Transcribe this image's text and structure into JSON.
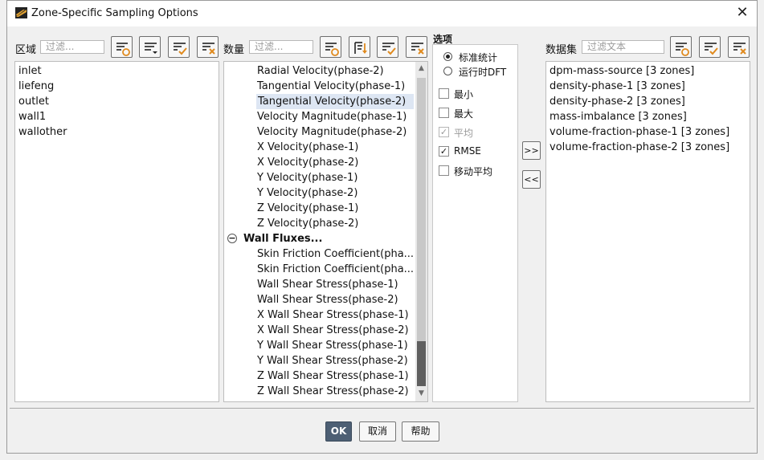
{
  "window": {
    "title": "Zone-Specific Sampling Options",
    "close_glyph": "✕"
  },
  "zones": {
    "label": "区域",
    "filter_placeholder": "过滤...",
    "items": [
      "inlet",
      "liefeng",
      "outlet",
      "wall1",
      "wallother"
    ]
  },
  "quantities": {
    "label": "数量",
    "filter_placeholder": "过滤...",
    "items": [
      {
        "text": "Radial Velocity(phase-2)"
      },
      {
        "text": "Tangential Velocity(phase-1)"
      },
      {
        "text": "Tangential Velocity(phase-2)",
        "selected": true
      },
      {
        "text": "Velocity Magnitude(phase-1)"
      },
      {
        "text": "Velocity Magnitude(phase-2)"
      },
      {
        "text": "X Velocity(phase-1)"
      },
      {
        "text": "X Velocity(phase-2)"
      },
      {
        "text": "Y Velocity(phase-1)"
      },
      {
        "text": "Y Velocity(phase-2)"
      },
      {
        "text": "Z Velocity(phase-1)"
      },
      {
        "text": "Z Velocity(phase-2)"
      },
      {
        "text": "Wall Fluxes...",
        "group": true
      },
      {
        "text": "Skin Friction Coefficient(pha..."
      },
      {
        "text": "Skin Friction Coefficient(pha..."
      },
      {
        "text": "Wall Shear Stress(phase-1)"
      },
      {
        "text": "Wall Shear Stress(phase-2)"
      },
      {
        "text": "X Wall Shear Stress(phase-1)"
      },
      {
        "text": "X Wall Shear Stress(phase-2)"
      },
      {
        "text": "Y Wall Shear Stress(phase-1)"
      },
      {
        "text": "Y Wall Shear Stress(phase-2)"
      },
      {
        "text": "Z Wall Shear Stress(phase-1)"
      },
      {
        "text": "Z Wall Shear Stress(phase-2)"
      }
    ],
    "collapse_glyph": "−"
  },
  "options": {
    "label": "选项",
    "radios": [
      {
        "text": "标准统计",
        "checked": true
      },
      {
        "text": "运行时DFT",
        "checked": false
      }
    ],
    "checks": [
      {
        "text": "最小",
        "checked": false,
        "disabled": false
      },
      {
        "text": "最大",
        "checked": false,
        "disabled": false
      },
      {
        "text": "平均",
        "checked": true,
        "disabled": true
      },
      {
        "text": "RMSE",
        "checked": true,
        "disabled": false
      },
      {
        "text": "移动平均",
        "checked": false,
        "disabled": false
      }
    ]
  },
  "move": {
    "add": ">>",
    "remove": "<<"
  },
  "datasets": {
    "label": "数据集",
    "filter_placeholder": "过滤文本",
    "items": [
      "dpm-mass-source [3 zones]",
      "density-phase-1 [3 zones]",
      "density-phase-2 [3 zones]",
      "mass-imbalance [3 zones]",
      "volume-fraction-phase-1 [3 zones]",
      "volume-fraction-phase-2 [3 zones]"
    ]
  },
  "buttons": {
    "ok": "OK",
    "cancel": "取消",
    "help": "帮助"
  },
  "colors": {
    "primary_button": "#4d5f74",
    "selection": "#dde6f3",
    "accent_orange": "#e08a1e"
  }
}
